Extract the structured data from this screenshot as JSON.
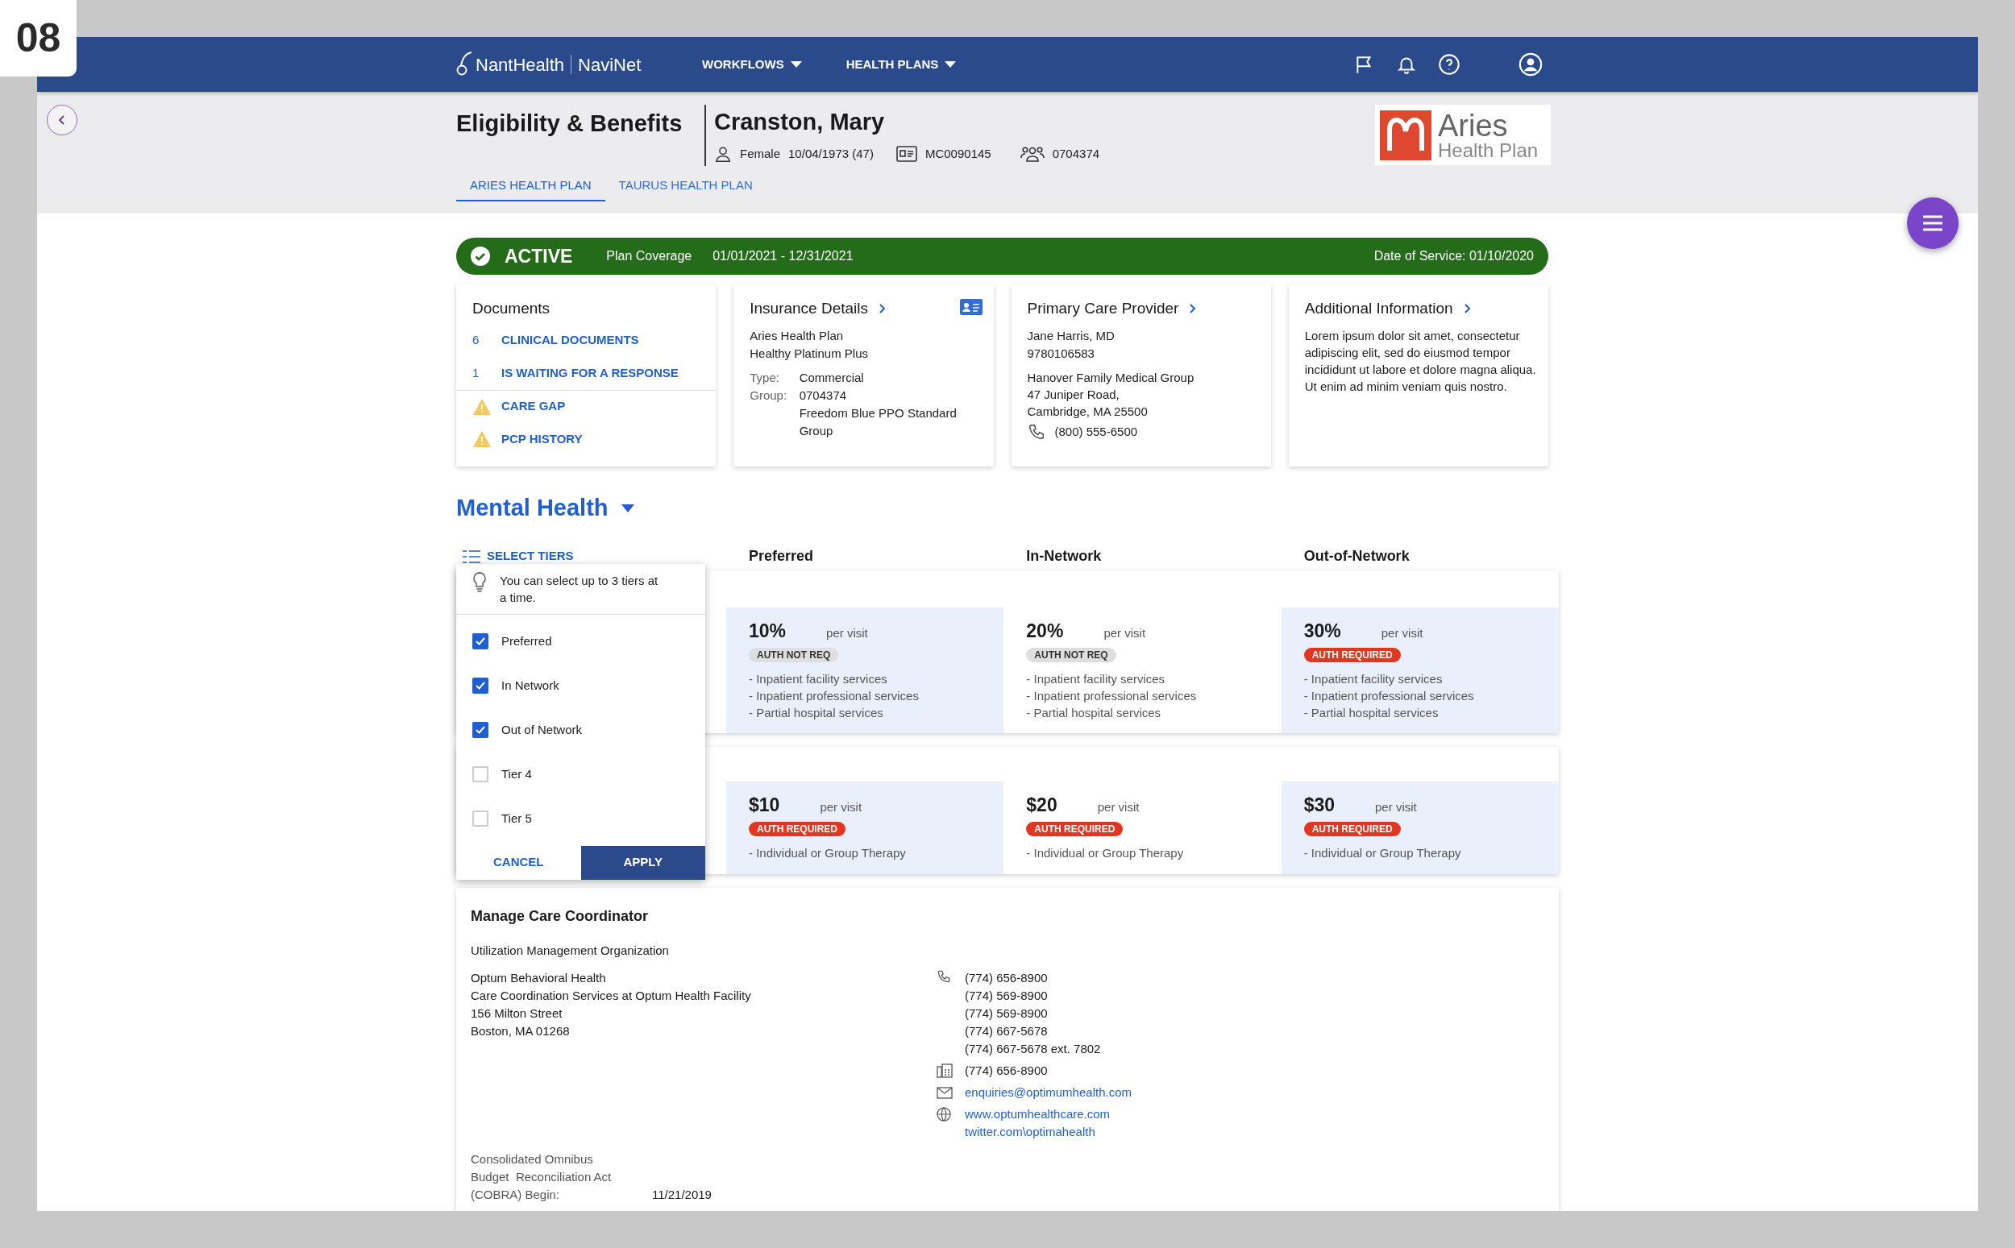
{
  "badge": "08",
  "nav": {
    "brand": "NantHealth",
    "product": "NaviNet",
    "menus": [
      {
        "label": "WORKFLOWS"
      },
      {
        "label": "HEALTH PLANS"
      }
    ]
  },
  "header": {
    "title": "Eligibility & Benefits",
    "patient": {
      "name": "Cranston, Mary",
      "gender": "Female",
      "dob": "10/04/1973 (47)",
      "member_id": "MC0090145",
      "group_id": "0704374"
    },
    "plan_logo": {
      "name": "Aries",
      "subtitle": "Health Plan"
    }
  },
  "tabs": [
    {
      "label": "ARIES HEALTH PLAN",
      "selected": true
    },
    {
      "label": "TAURUS HEALTH PLAN",
      "selected": false
    }
  ],
  "status_bar": {
    "status": "ACTIVE",
    "coverage_label": "Plan Coverage",
    "coverage": "01/01/2021 - 12/31/2021",
    "date_of_service": "Date of Service: 01/10/2020"
  },
  "documents": {
    "title": "Documents",
    "items": [
      {
        "kind": "count",
        "count": "6",
        "label": "CLINICAL DOCUMENTS"
      },
      {
        "kind": "count",
        "count": "1",
        "label": "IS WAITING FOR A RESPONSE"
      },
      {
        "kind": "warning",
        "label": "CARE GAP"
      },
      {
        "kind": "warning",
        "label": "PCP HISTORY"
      }
    ]
  },
  "insurance": {
    "title": "Insurance Details",
    "lines": [
      "Aries Health Plan",
      "Healthy Platinum Plus"
    ],
    "fields": [
      {
        "label": "Type:",
        "values": [
          "Commercial"
        ]
      },
      {
        "label": "Group:",
        "values": [
          "0704374",
          "Freedom Blue PPO Standard Group"
        ]
      }
    ]
  },
  "pcp": {
    "title": "Primary Care Provider",
    "lines": [
      "Jane Harris, MD",
      "9780106583"
    ],
    "address": [
      "Hanover Family Medical Group",
      "47 Juniper Road,",
      "Cambridge, MA 25500"
    ],
    "phone": "(800) 555-6500"
  },
  "additional": {
    "title": "Additional Information",
    "text": "Lorem ipsum dolor sit amet, consectetur adipiscing elit, sed do eiusmod tempor incididunt ut labore et dolore magna aliqua. Ut enim ad minim veniam quis nostro."
  },
  "benefits": {
    "title": "Mental Health",
    "select_tiers": "SELECT TIERS",
    "columns": [
      "Preferred",
      "In-Network",
      "Out-of-Network"
    ],
    "rows": [
      {
        "cells": [
          {
            "amount": "10%",
            "unit": "per visit",
            "auth": {
              "label": "AUTH NOT REQ",
              "required": false
            },
            "highlighted": true,
            "services": [
              "-  Inpatient facility services",
              "-  Inpatient professional services",
              "-  Partial hospital services"
            ]
          },
          {
            "amount": "20%",
            "unit": "per visit",
            "auth": {
              "label": "AUTH NOT REQ",
              "required": false
            },
            "highlighted": false,
            "services": [
              "-  Inpatient facility services",
              "-  Inpatient professional  services",
              "-  Partial hospital services"
            ]
          },
          {
            "amount": "30%",
            "unit": "per visit",
            "auth": {
              "label": "AUTH REQUIRED",
              "required": true
            },
            "highlighted": true,
            "services": [
              "-  Inpatient facility services",
              "-  Inpatient professional services",
              "-  Partial hospital services"
            ]
          }
        ]
      },
      {
        "cells": [
          {
            "amount": "$10",
            "unit": "per visit",
            "auth": {
              "label": "AUTH REQUIRED",
              "required": true
            },
            "highlighted": true,
            "services": [
              "- Individual or Group Therapy"
            ]
          },
          {
            "amount": "$20",
            "unit": "per visit",
            "auth": {
              "label": "AUTH REQUIRED",
              "required": true
            },
            "highlighted": false,
            "services": [
              "- Individual or Group Therapy"
            ]
          },
          {
            "amount": "$30",
            "unit": "per visit",
            "auth": {
              "label": "AUTH REQUIRED",
              "required": true
            },
            "highlighted": true,
            "services": [
              "- Individual or Group Therapy"
            ]
          }
        ]
      }
    ]
  },
  "tier_menu": {
    "hint": "You can select up to 3 tiers at a time.",
    "options": [
      {
        "label": "Preferred",
        "checked": true
      },
      {
        "label": "In Network",
        "checked": true
      },
      {
        "label": "Out of Network",
        "checked": true
      },
      {
        "label": "Tier 4",
        "checked": false
      },
      {
        "label": "Tier 5",
        "checked": false
      }
    ],
    "cancel": "CANCEL",
    "apply": "APPLY"
  },
  "care_coordinator": {
    "title": "Manage Care Coordinator",
    "org_label": "Utilization Management Organization",
    "address": [
      "Optum Behavioral Health",
      "Care Coordination Services at Optum Health Facility",
      "156 Milton Street",
      "Boston, MA 01268"
    ],
    "phones": [
      "(774) 656-8900",
      "(774) 569-8900",
      "(774) 569-8900",
      "(774) 667-5678",
      "(774) 667-5678 ext. 7802"
    ],
    "fax": "(774) 656-8900",
    "email": "enquiries@optimumhealth.com",
    "web": [
      "www.optumhealthcare.com",
      "twitter.com\\optimahealth"
    ],
    "cobra": {
      "label": [
        "Consolidated Omnibus",
        "Budget  Reconciliation Act",
        "(COBRA) Begin:"
      ],
      "value": "11/21/2019"
    }
  }
}
